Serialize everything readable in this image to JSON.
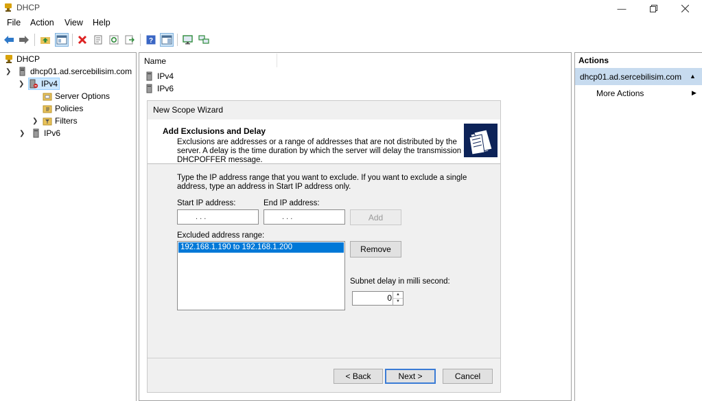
{
  "window": {
    "title": "DHCP"
  },
  "menu": [
    "File",
    "Action",
    "View",
    "Help"
  ],
  "tree": {
    "root": "DHCP",
    "server": "dhcp01.ad.sercebilisim.com",
    "ipv4": "IPv4",
    "server_options": "Server Options",
    "policies": "Policies",
    "filters": "Filters",
    "ipv6": "IPv6"
  },
  "list": {
    "column_name": "Name",
    "items": [
      "IPv4",
      "IPv6"
    ]
  },
  "wizard": {
    "title": "New Scope Wizard",
    "heading": "Add Exclusions and Delay",
    "description_lines": [
      "Exclusions are addresses or a range of addresses that are not distributed by the",
      "server. A delay is the time duration by which the server will delay the transmission of a",
      "DHCPOFFER message."
    ],
    "instruction_lines": [
      "Type the IP address range that you want to exclude. If you want to exclude a single",
      "address, type an address in Start IP address only."
    ],
    "start_ip_label": "Start IP address:",
    "end_ip_label": "End IP address:",
    "ip_placeholder": ".       .       .",
    "add_button": "Add",
    "excluded_label": "Excluded address range:",
    "excluded_items": [
      "192.168.1.190 to 192.168.1.200"
    ],
    "remove_button": "Remove",
    "delay_label": "Subnet delay in milli second:",
    "delay_value": "0",
    "back_button": "< Back",
    "next_button": "Next >",
    "cancel_button": "Cancel"
  },
  "actions": {
    "header": "Actions",
    "section": "dhcp01.ad.sercebilisim.com",
    "more": "More Actions"
  },
  "colors": {
    "selection": "#0078d7",
    "actions_section_bg": "#c7dbef",
    "wizard_bg": "#f0f0f0"
  }
}
